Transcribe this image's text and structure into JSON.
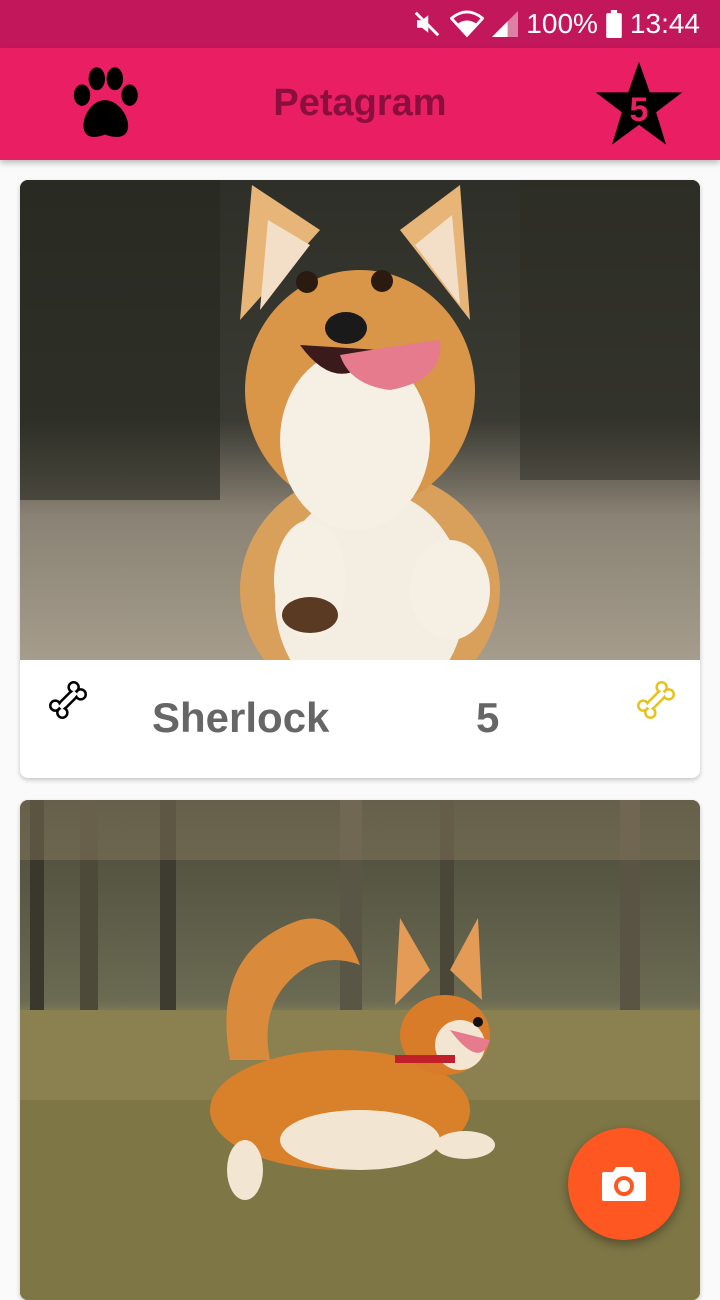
{
  "status_bar": {
    "battery_text": "100%",
    "time": "13:44",
    "icons": [
      "mute-icon",
      "wifi-icon",
      "signal-icon",
      "battery-icon"
    ]
  },
  "app_bar": {
    "title": "Petagram",
    "left_icon": "paw-icon",
    "favorites_count": "5",
    "favorites_icon": "star-icon"
  },
  "pets": [
    {
      "name": "Sherlock",
      "rating": "5",
      "like_icon": "bone-icon",
      "rating_icon": "bone-icon",
      "photo": "corgi-running-photo"
    },
    {
      "photo": "corgi-field-photo"
    }
  ],
  "fab": {
    "icon": "camera-icon"
  },
  "colors": {
    "status_bar": "#c2185b",
    "primary": "#e91e63",
    "title_text": "#8b0f3c",
    "accent_fab": "#ff5722",
    "rating_bone": "#e6c220",
    "text_gray": "#666666"
  }
}
